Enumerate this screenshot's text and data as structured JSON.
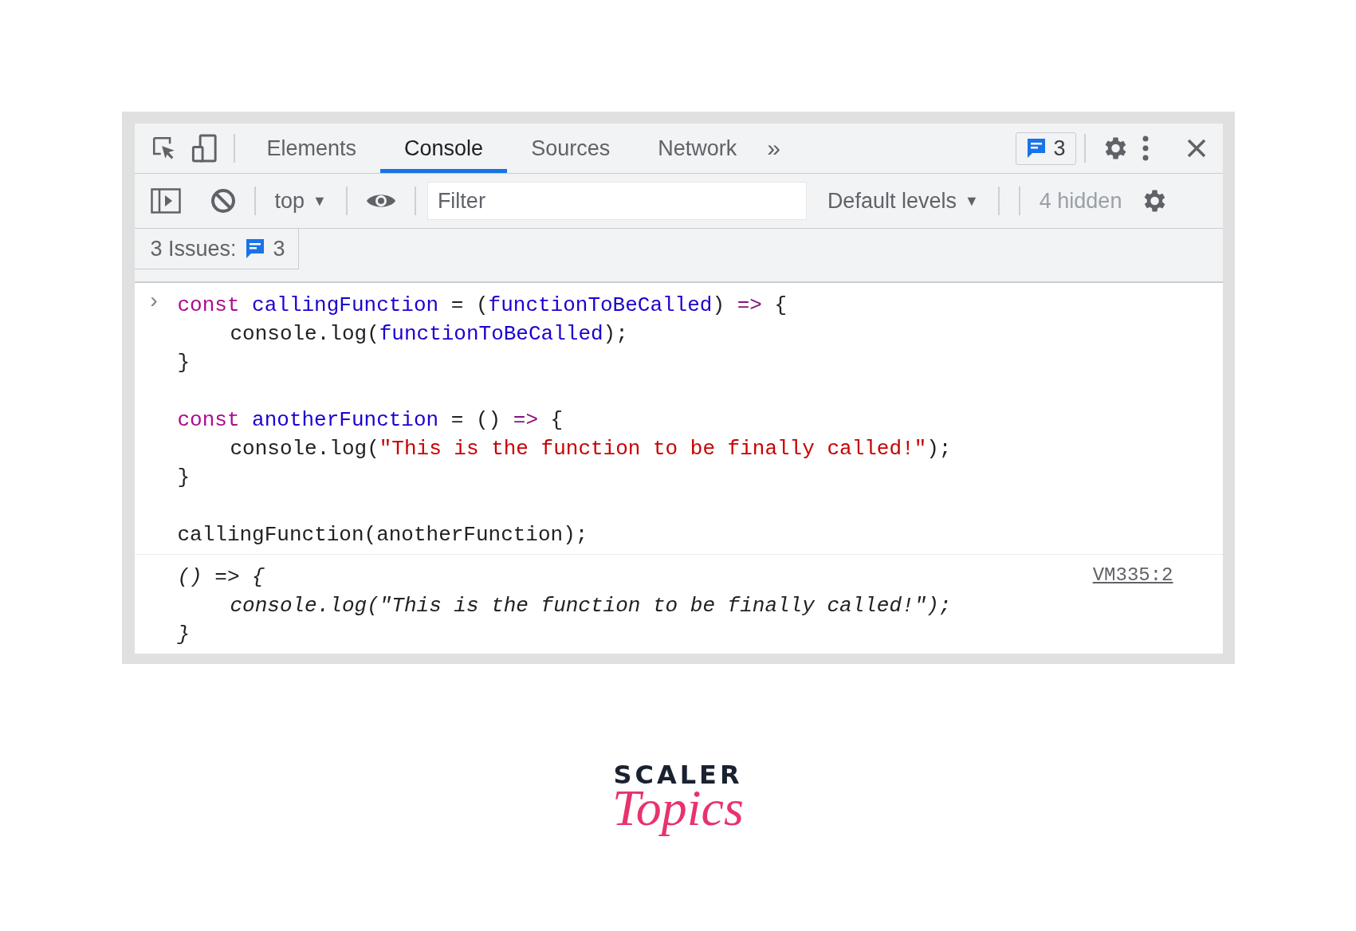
{
  "toolbar": {
    "tabs": [
      {
        "label": "Elements",
        "selected": false
      },
      {
        "label": "Console",
        "selected": true
      },
      {
        "label": "Sources",
        "selected": false
      },
      {
        "label": "Network",
        "selected": false
      }
    ],
    "more": "»",
    "issues_badge": "3"
  },
  "console_toolbar": {
    "context": "top",
    "context_arrow": "▼",
    "filter": {
      "placeholder": "Filter"
    },
    "levels": "Default levels",
    "levels_arrow": "▼",
    "hidden": "4 hidden"
  },
  "issues": {
    "label": "3 Issues:",
    "count": "3"
  },
  "input": {
    "prompt": "›",
    "lines": [
      {
        "kind": "top",
        "tokens": [
          {
            "kind": "keyword",
            "text": "const"
          },
          {
            "kind": "name",
            "text": "callingFunction"
          },
          {
            "kind": "plain",
            "text": " = ("
          },
          {
            "kind": "name",
            "text": "functionToBeCalled"
          },
          {
            "kind": "plain",
            "text": ") "
          },
          {
            "kind": "op",
            "text": "=>"
          },
          {
            "kind": "plain",
            "text": " {"
          }
        ]
      },
      {
        "kind": "indented",
        "tokens": [
          {
            "kind": "plain",
            "text": "console.log("
          },
          {
            "kind": "name",
            "text": "functionToBeCalled"
          },
          {
            "kind": "plain",
            "text": ");"
          }
        ]
      },
      {
        "kind": "top",
        "tokens": [
          {
            "kind": "plain",
            "text": "}"
          }
        ]
      },
      {
        "kind": "blank"
      },
      {
        "kind": "top",
        "tokens": [
          {
            "kind": "keyword",
            "text": "const"
          },
          {
            "kind": "name",
            "text": "anotherFunction"
          },
          {
            "kind": "plain",
            "text": " = () "
          },
          {
            "kind": "op",
            "text": "=>"
          },
          {
            "kind": "plain",
            "text": " {"
          }
        ]
      },
      {
        "kind": "indented",
        "tokens": [
          {
            "kind": "plain",
            "text": "console.log("
          },
          {
            "kind": "string",
            "text": "\"This is the function to be finally called!\""
          },
          {
            "kind": "plain",
            "text": ");"
          }
        ]
      },
      {
        "kind": "top",
        "tokens": [
          {
            "kind": "plain",
            "text": "}"
          }
        ]
      },
      {
        "kind": "blank"
      },
      {
        "kind": "top",
        "tokens": [
          {
            "kind": "plain",
            "text": "callingFunction(anotherFunction);"
          }
        ]
      }
    ]
  },
  "output": {
    "source": "VM335:2",
    "lines": [
      {
        "kind": "top",
        "text": "() => {"
      },
      {
        "kind": "indented",
        "text": "console.log(\"This is the function to be finally called!\");"
      },
      {
        "kind": "top",
        "text": "}"
      }
    ]
  },
  "logo": {
    "brand": "SCALER",
    "tagline": "Topics"
  }
}
